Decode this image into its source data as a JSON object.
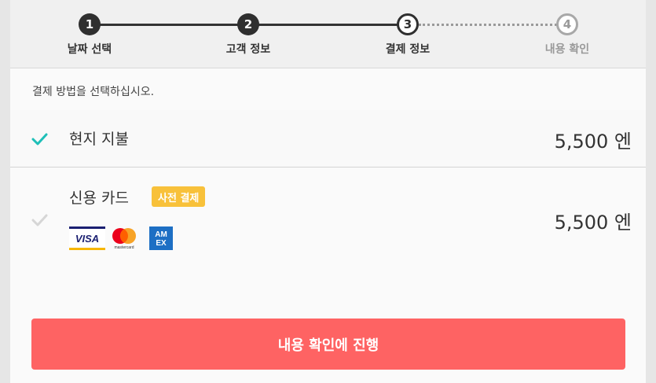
{
  "stepper": {
    "steps": [
      {
        "number": "1",
        "label": "날짜 선택",
        "state": "done"
      },
      {
        "number": "2",
        "label": "고객 정보",
        "state": "done"
      },
      {
        "number": "3",
        "label": "결제 정보",
        "state": "current"
      },
      {
        "number": "4",
        "label": "내용 확인",
        "state": "todo"
      }
    ]
  },
  "instruction": "결제 방법을 선택하십시오.",
  "payment_options": [
    {
      "title": "현지 지불",
      "price": "5,500 엔",
      "selected": true,
      "check_color": "#1fbfb8"
    },
    {
      "title": "신용 카드",
      "badge": "사전 결제",
      "price": "5,500 엔",
      "selected": false,
      "check_color": "#d6d6d6",
      "card_icons": [
        "visa-icon",
        "mastercard-icon",
        "amex-icon"
      ],
      "card_text": {
        "visa": "VISA",
        "mastercard": "mastercard",
        "amex_top": "AM",
        "amex_bottom": "EX"
      }
    }
  ],
  "cta_label": "내용 확인에 진행",
  "colors": {
    "accent": "#fe6363",
    "badge": "#f8c13a",
    "check": "#1fbfb8"
  }
}
